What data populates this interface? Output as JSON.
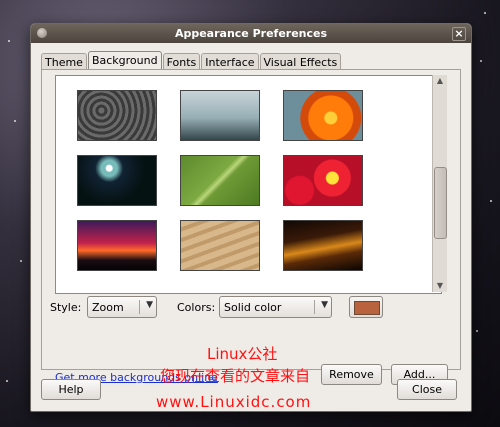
{
  "window": {
    "title": "Appearance Preferences",
    "close_glyph": "×"
  },
  "tabs": [
    {
      "label": "Theme"
    },
    {
      "label": "Background",
      "active": true
    },
    {
      "label": "Fonts"
    },
    {
      "label": "Interface"
    },
    {
      "label": "Visual Effects"
    }
  ],
  "gallery": {
    "thumbnails": [
      {
        "name": "dark-texture"
      },
      {
        "name": "foggy-shore"
      },
      {
        "name": "orange-flower"
      },
      {
        "name": "night-lights"
      },
      {
        "name": "green-leaf"
      },
      {
        "name": "red-primroses"
      },
      {
        "name": "red-sunset"
      },
      {
        "name": "sand-dunes"
      },
      {
        "name": "orange-dusk"
      }
    ]
  },
  "style": {
    "label": "Style:",
    "value": "Zoom"
  },
  "colors": {
    "label": "Colors:",
    "value": "Solid color",
    "swatch": "#b8633d"
  },
  "actions": {
    "get_more": "Get more backgrounds online",
    "remove": "Remove",
    "add": "Add...",
    "help": "Help",
    "close": "Close"
  },
  "watermark": {
    "line1": "Linux公社",
    "line2": "您现在查看的文章来自",
    "line3": "www.Linuxidc.com"
  },
  "accent_colors": {
    "titlebar": "#5c544c",
    "link": "#1a2fcf",
    "watermark": "#ff1111"
  }
}
